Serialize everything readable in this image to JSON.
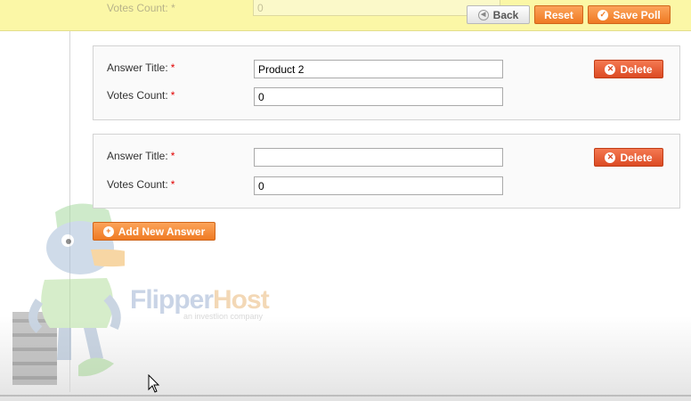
{
  "header": {
    "ghost_label": "Votes Count:",
    "ghost_value": "0",
    "back_label": "Back",
    "reset_label": "Reset",
    "save_label": "Save Poll"
  },
  "answers": [
    {
      "title_label": "Answer Title:",
      "votes_label": "Votes Count:",
      "required_mark": "*",
      "title_value": "Product 2",
      "votes_value": "0",
      "delete_label": "Delete"
    },
    {
      "title_label": "Answer Title:",
      "votes_label": "Votes Count:",
      "required_mark": "*",
      "title_value": "",
      "votes_value": "0",
      "delete_label": "Delete"
    }
  ],
  "add_answer_label": "Add New Answer",
  "watermark": {
    "brand_flipper": "Flipper",
    "brand_host": "Host",
    "tagline": "an investlion company"
  },
  "colors": {
    "accent_orange": "#ef7a23",
    "delete_red": "#dc4a23",
    "header_yellow": "#fbf7a6",
    "required_red": "#e20000"
  }
}
